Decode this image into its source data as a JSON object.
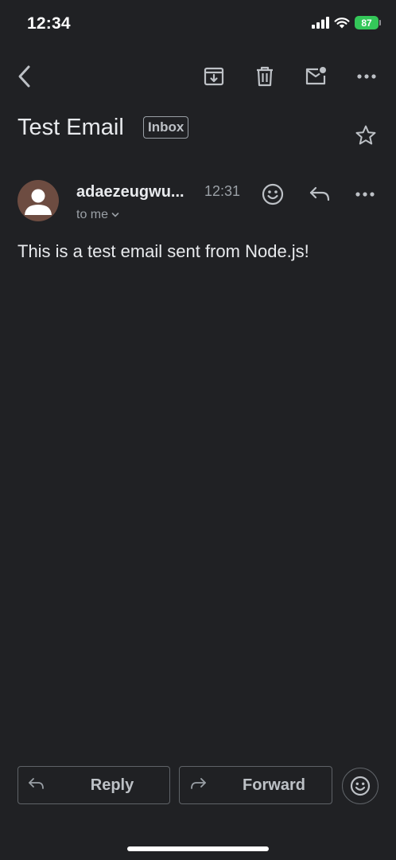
{
  "status": {
    "time": "12:34",
    "battery": "87"
  },
  "toolbar": {
    "icons": [
      "back-icon",
      "archive-icon",
      "delete-icon",
      "mark-unread-icon",
      "more-icon"
    ]
  },
  "email": {
    "subject": "Test Email",
    "label": "Inbox",
    "sender": "adaezeugwu...",
    "time": "12:31",
    "recipient": "to me",
    "body": "This is a test email sent from Node.js!"
  },
  "actions": {
    "reply": "Reply",
    "forward": "Forward"
  },
  "colors": {
    "background": "#202124",
    "text": "#e8eaed",
    "muted": "#9aa0a6",
    "avatar": "#6d4c41",
    "battery": "#34c759"
  }
}
